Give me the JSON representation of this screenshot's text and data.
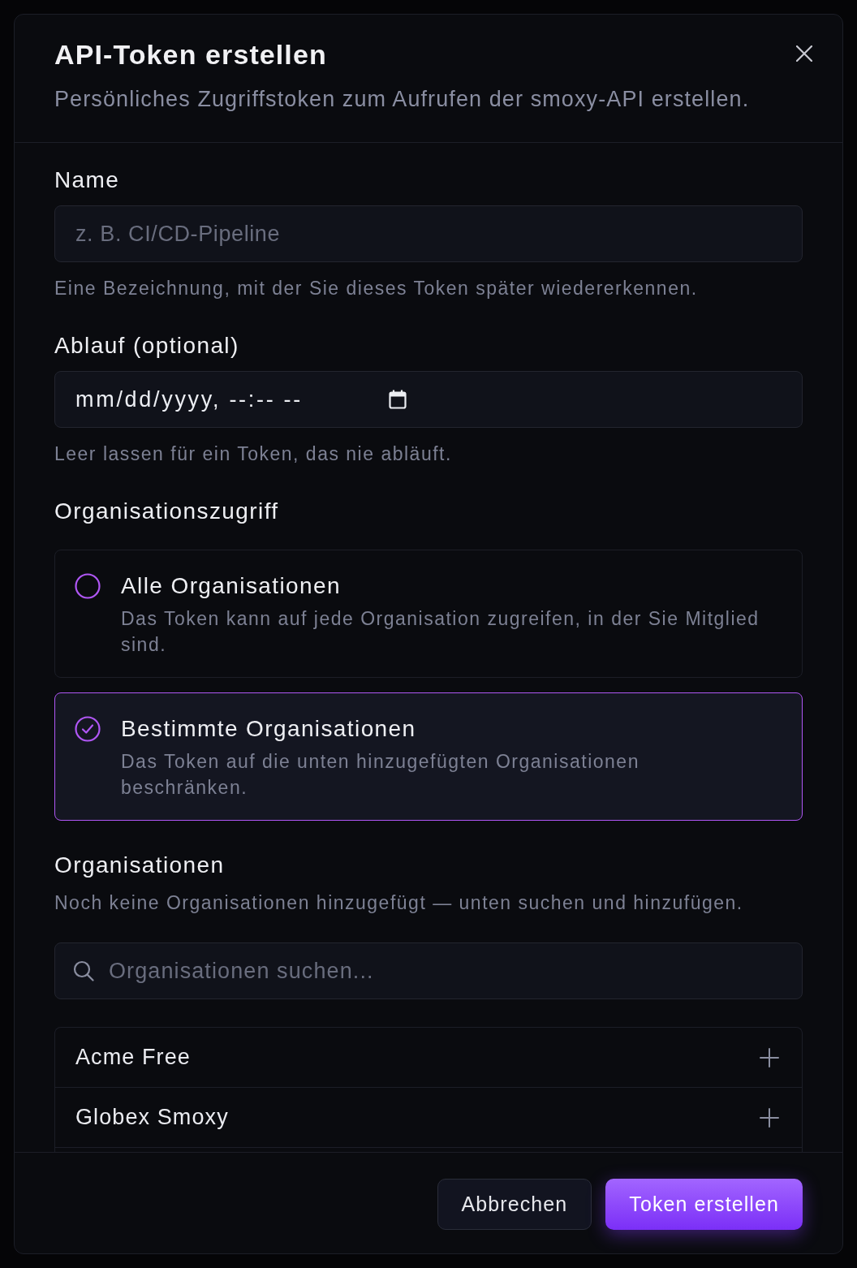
{
  "dialog": {
    "title": "API-Token erstellen",
    "subtitle": "Persönliches Zugriffstoken zum Aufrufen der smoxy-API erstellen."
  },
  "fields": [
    {
      "kind": "text",
      "label": "Name",
      "placeholder": "z. B. CI/CD-Pipeline",
      "hint": "Eine Bezeichnung, mit der Sie dieses Token später wiedererkennen."
    },
    {
      "kind": "datetime",
      "label": "Ablauf (optional)",
      "value": "mm/dd/yyyy, --:-- --",
      "hint": "Leer lassen für ein Token, das nie abläuft."
    }
  ],
  "access": {
    "label": "Organisationszugriff",
    "options": [
      {
        "title": "Alle Organisationen",
        "description": "Das Token kann auf jede Organisation zugreifen, in der Sie Mitglied sind.",
        "selected": false
      },
      {
        "title": "Bestimmte Organisationen",
        "description": "Das Token auf die unten hinzugefügten Organisationen beschränken.",
        "selected": true
      }
    ]
  },
  "organizations": {
    "label": "Organisationen",
    "note": "Noch keine Organisationen hinzugefügt — unten suchen und hinzufügen.",
    "search": {
      "placeholder": "Organisationen suchen..."
    },
    "items": [
      {
        "name": "Acme Free"
      },
      {
        "name": "Globex Smoxy"
      }
    ]
  },
  "buttons": [
    {
      "kind": "secondary",
      "label": "Abbrechen"
    },
    {
      "kind": "primary",
      "label": "Token erstellen"
    }
  ]
}
